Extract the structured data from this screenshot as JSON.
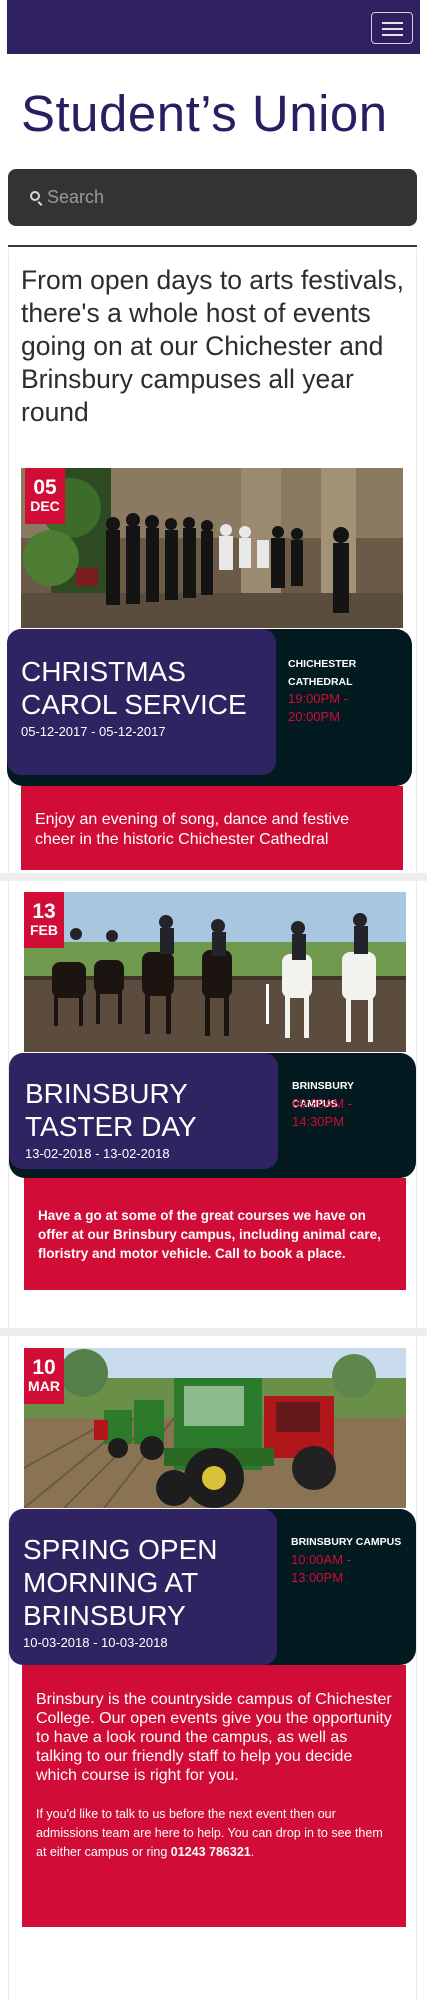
{
  "header": {
    "title": "Student’s Union",
    "menu_icon": "hamburger-icon"
  },
  "search": {
    "placeholder": "Search",
    "icon": "search-icon"
  },
  "intro": "From open days to arts festivals, there's a whole host of events going on at our Chichester and Brinsbury campuses all year round",
  "colors": {
    "navy": "#2f2060",
    "purple": "#302362",
    "crimson": "#d00c37",
    "dark_teal": "#021a20"
  },
  "events": [
    {
      "day": "05",
      "month": "DEC",
      "title": "CHRISTMAS CAROL SERVICE",
      "dates": "05-12-2017 - 05-12-2017",
      "location": "CHICHESTER CATHEDRAL",
      "time": "19:00PM - 20:00PM",
      "description": "Enjoy an evening of song, dance and festive cheer in the historic Chichester Cathedral"
    },
    {
      "day": "13",
      "month": "FEB",
      "title": "BRINSBURY TASTER DAY",
      "dates": "13-02-2018 - 13-02-2018",
      "location": "BRINSBURY CAMPUS",
      "time": "09:30AM - 14:30PM",
      "description": "Have a go at some of the great courses we have on offer at our Brinsbury campus, including animal care, floristry and motor vehicle. Call to book a place."
    },
    {
      "day": "10",
      "month": "MAR",
      "title": "SPRING OPEN MORNING AT BRINSBURY",
      "dates": "10-03-2018 - 10-03-2018",
      "location": "BRINSBURY CAMPUS",
      "time": "10:00AM - 13:00PM",
      "description": "Brinsbury is the countryside campus of Chichester College. Our open events give you the opportunity to have a look round the campus, as well as talking to our friendly staff to help you decide which course is right for you.",
      "note_prefix": "If you'd like to talk to us before the next event then our admissions team are here to help.  You can drop in to see them at either campus or ring ",
      "phone": "01243 786321",
      "note_suffix": "."
    }
  ]
}
